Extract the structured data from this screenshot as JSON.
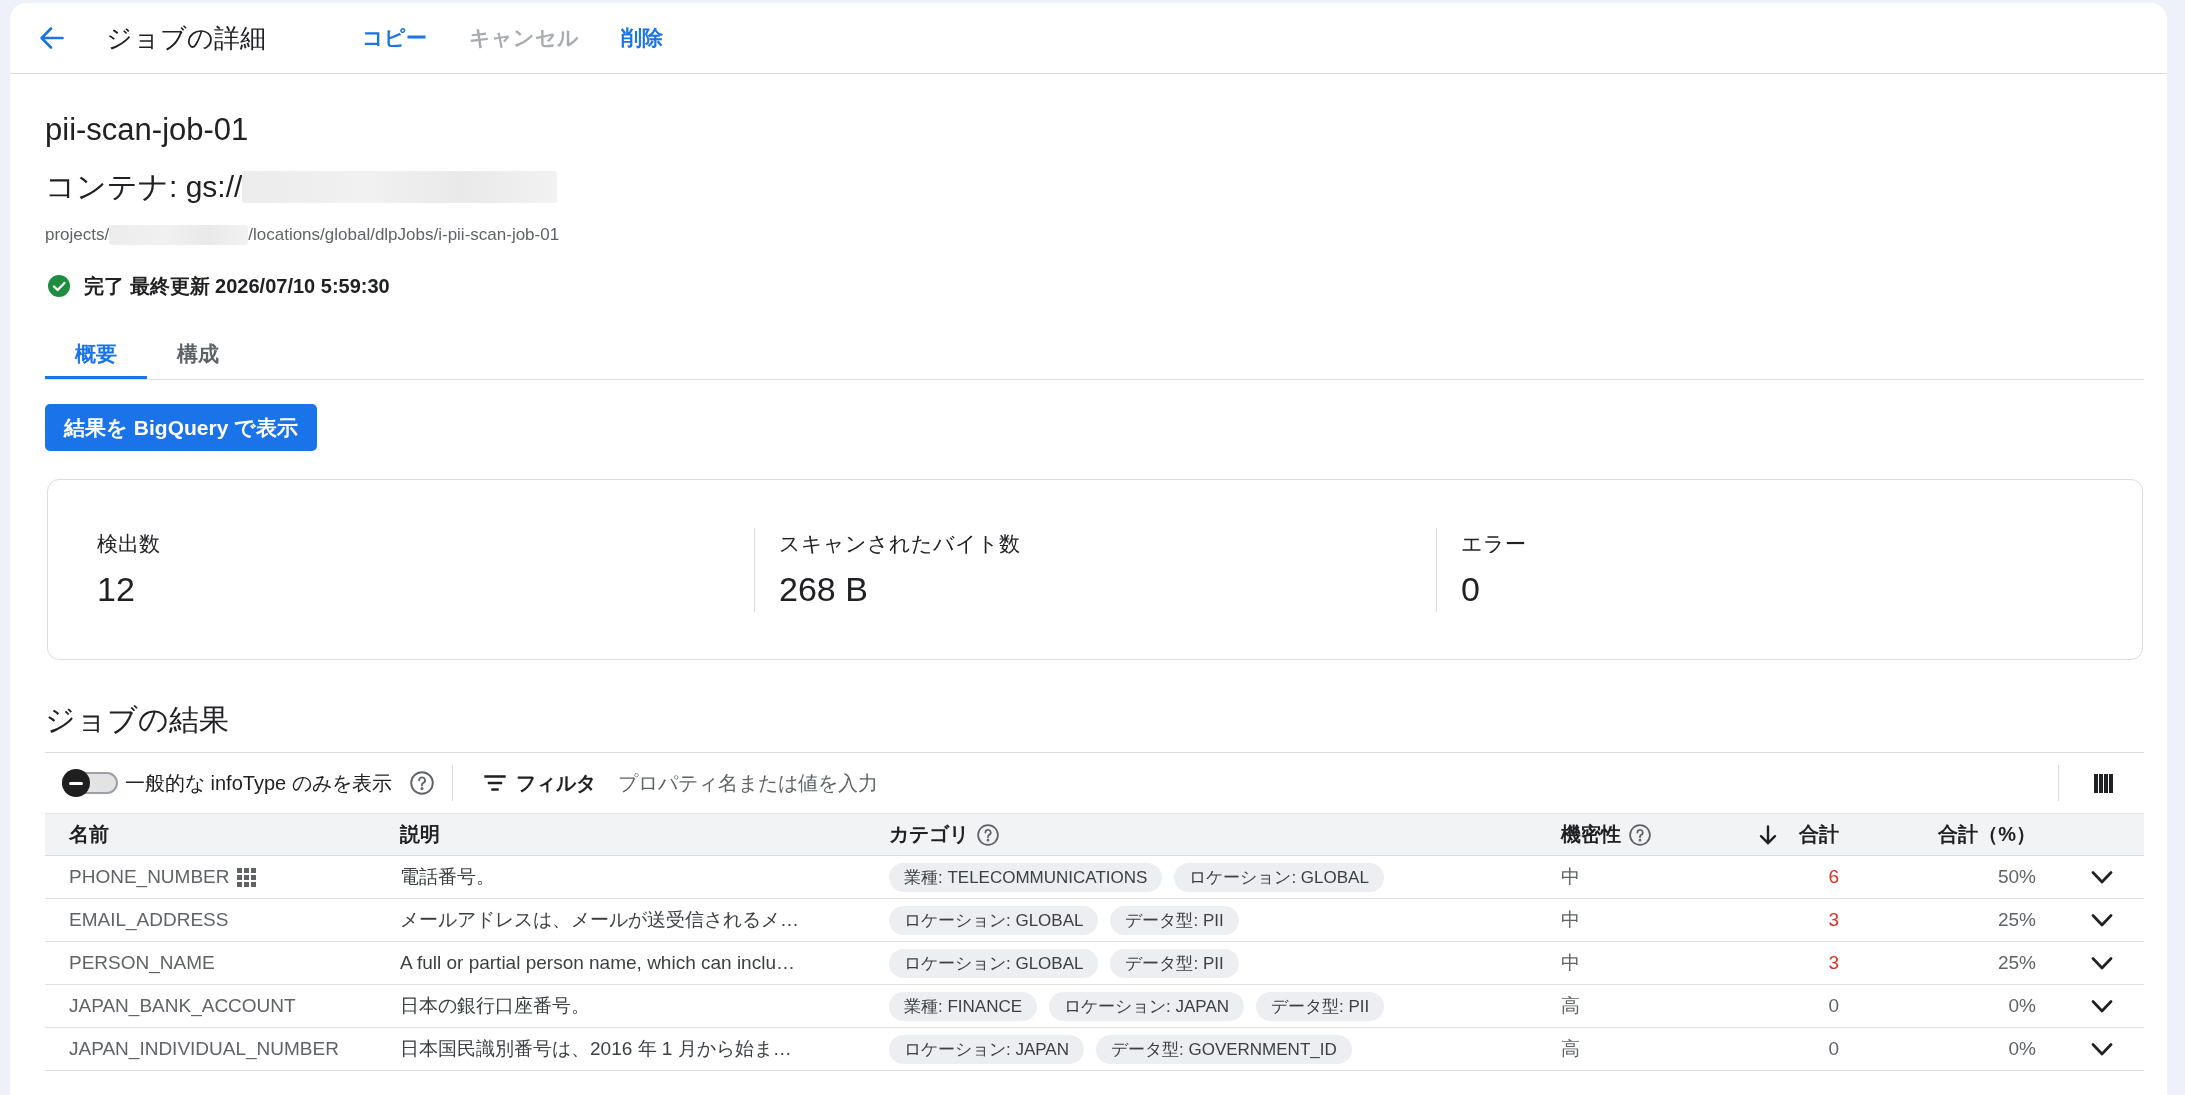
{
  "header": {
    "title": "ジョブの詳細",
    "actions": [
      {
        "label": "コピー",
        "disabled": false
      },
      {
        "label": "キャンセル",
        "disabled": true
      },
      {
        "label": "削除",
        "disabled": false
      }
    ]
  },
  "job": {
    "name": "pii-scan-job-01",
    "container": {
      "label": "コンテナ: gs://",
      "redacted": true
    },
    "path": {
      "prefix": "projects/",
      "redacted": true,
      "suffix": "/locations/global/dlpJobs/i-pii-scan-job-01"
    },
    "status": {
      "kind": "done",
      "text": "完了 最終更新 2026/07/10 5:59:30"
    }
  },
  "tabs": [
    {
      "label": "概要",
      "selected": true
    },
    {
      "label": "構成",
      "selected": false
    }
  ],
  "primary_button": "結果を BigQuery で表示",
  "stats": [
    {
      "label": "検出数",
      "value": "12"
    },
    {
      "label": "スキャンされたバイト数",
      "value": "268 B"
    },
    {
      "label": "エラー",
      "value": "0"
    }
  ],
  "results": {
    "title": "ジョブの結果",
    "toggle": {
      "label": "一般的な infoType のみを表示",
      "on": false
    },
    "filter": {
      "label": "フィルタ",
      "placeholder": "プロパティ名または値を入力"
    },
    "columns": [
      {
        "label": "名前",
        "help": false,
        "sorted": false
      },
      {
        "label": "説明",
        "help": false,
        "sorted": false
      },
      {
        "label": "カテゴリ",
        "help": true,
        "sorted": false
      },
      {
        "label": "機密性",
        "help": true,
        "sorted": false
      },
      {
        "label": "合計",
        "help": false,
        "sorted": true
      },
      {
        "label": "合計（%）",
        "help": false,
        "sorted": false
      }
    ],
    "rows": [
      {
        "name": "PHONE_NUMBER",
        "grid_icon": true,
        "description": "電話番号。",
        "categories": [
          "業種: TELECOMMUNICATIONS",
          "ロケーション: GLOBAL"
        ],
        "sensitivity": "中",
        "total": "6",
        "highlighted": true,
        "total_pct": "50%",
        "expanded": false
      },
      {
        "name": "EMAIL_ADDRESS",
        "grid_icon": false,
        "description": "メールアドレスは、メールが送受信されるメ…",
        "categories": [
          "ロケーション: GLOBAL",
          "データ型: PII"
        ],
        "sensitivity": "中",
        "total": "3",
        "highlighted": true,
        "total_pct": "25%",
        "expanded": false
      },
      {
        "name": "PERSON_NAME",
        "grid_icon": false,
        "description": "A full or partial person name, which can inclu…",
        "categories": [
          "ロケーション: GLOBAL",
          "データ型: PII"
        ],
        "sensitivity": "中",
        "total": "3",
        "highlighted": true,
        "total_pct": "25%",
        "expanded": false
      },
      {
        "name": "JAPAN_BANK_ACCOUNT",
        "grid_icon": false,
        "description": "日本の銀行口座番号。",
        "categories": [
          "業種: FINANCE",
          "ロケーション: JAPAN",
          "データ型: PII"
        ],
        "sensitivity": "高",
        "total": "0",
        "highlighted": false,
        "total_pct": "0%",
        "expanded": false
      },
      {
        "name": "JAPAN_INDIVIDUAL_NUMBER",
        "grid_icon": false,
        "description": "日本国民識別番号は、2016 年 1 月から始ま…",
        "categories": [
          "ロケーション: JAPAN",
          "データ型: GOVERNMENT_ID"
        ],
        "sensitivity": "高",
        "total": "0",
        "highlighted": false,
        "total_pct": "0%",
        "expanded": false
      }
    ]
  }
}
